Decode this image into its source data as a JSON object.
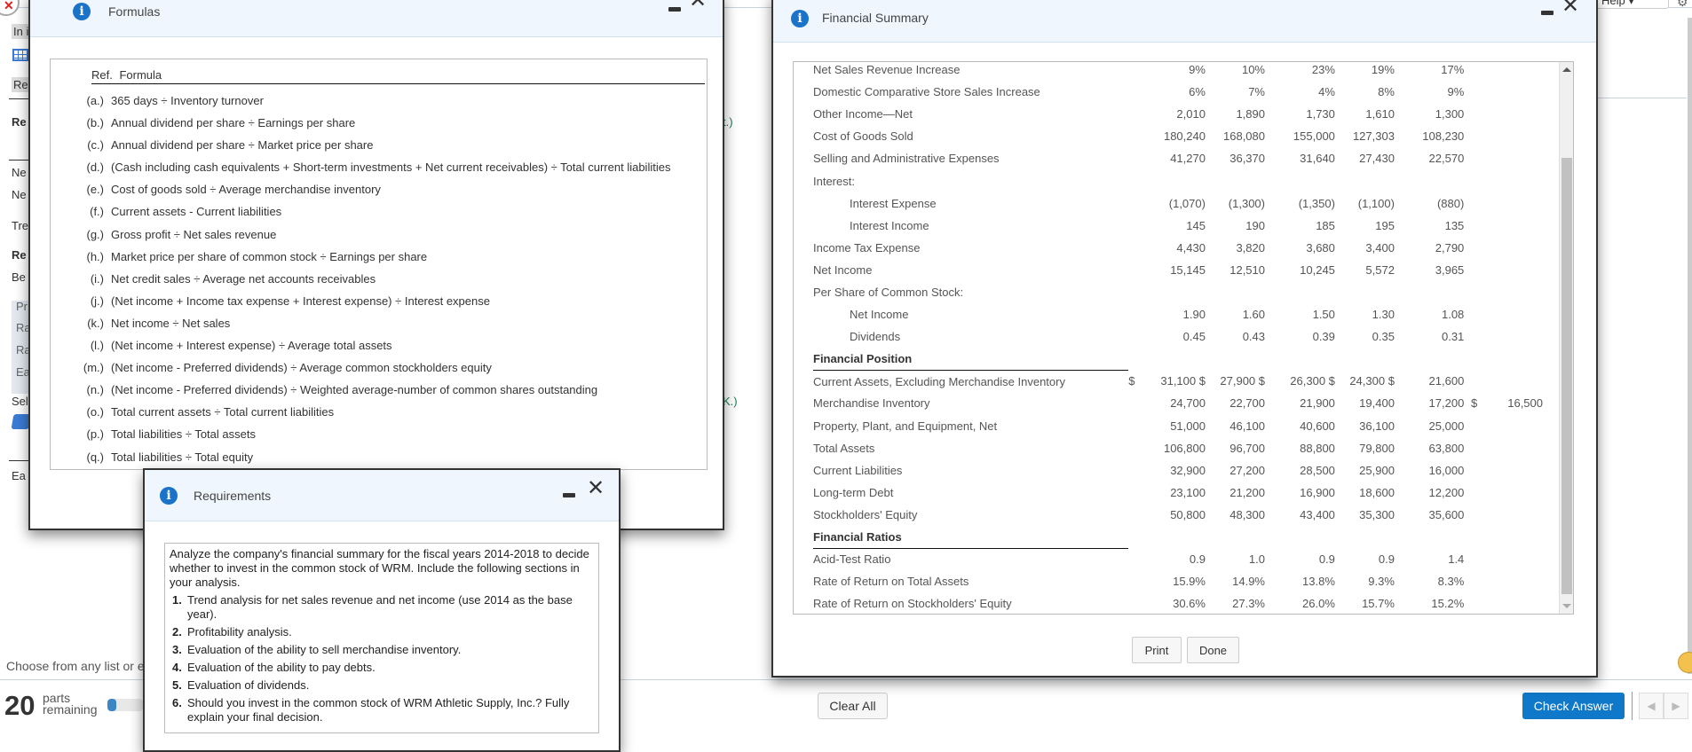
{
  "background": {
    "left_fragments": [
      "In i",
      "Re",
      "Re",
      "Ne",
      "Ne",
      "Tre",
      "Re",
      "Be",
      "Pr",
      "Ra",
      "Ra",
      "Ea",
      "Sel",
      "Ea"
    ],
    "green_fragment_1": "t.)",
    "green_fragment_2": "K.)",
    "choose_text": "Choose from any list or e",
    "parts_count": "20",
    "parts_label_1": "parts",
    "parts_label_2": "remaining",
    "progress_fraction": 0.25,
    "help_label": "Help ▾",
    "clear_all": "Clear All",
    "check_answer": "Check Answer"
  },
  "formulas": {
    "title": "Formulas",
    "header_ref": "Ref.",
    "header_formula": "Formula",
    "rows": [
      {
        "ref": "(a.)",
        "text": "365 days ÷ Inventory turnover"
      },
      {
        "ref": "(b.)",
        "text": "Annual dividend per share ÷ Earnings per share"
      },
      {
        "ref": "(c.)",
        "text": "Annual dividend per share ÷ Market price per share"
      },
      {
        "ref": "(d.)",
        "text": "(Cash including cash equivalents + Short-term investments + Net current receivables) ÷ Total current liabilities"
      },
      {
        "ref": "(e.)",
        "text": "Cost of goods sold ÷ Average merchandise inventory"
      },
      {
        "ref": "(f.)",
        "text": "Current assets - Current liabilities"
      },
      {
        "ref": "(g.)",
        "text": "Gross profit ÷ Net sales revenue"
      },
      {
        "ref": "(h.)",
        "text": "Market price per share of common stock ÷ Earnings per share"
      },
      {
        "ref": "(i.)",
        "text": "Net credit sales ÷ Average net accounts receivables"
      },
      {
        "ref": "(j.)",
        "text": "(Net income + Income tax expense + Interest expense) ÷ Interest expense"
      },
      {
        "ref": "(k.)",
        "text": "Net income ÷ Net sales"
      },
      {
        "ref": "(l.)",
        "text": "(Net income + Interest expense) ÷ Average total assets"
      },
      {
        "ref": "(m.)",
        "text": "(Net income - Preferred dividends) ÷ Average common stockholders equity"
      },
      {
        "ref": "(n.)",
        "text": "(Net income - Preferred dividends) ÷ Weighted average-number of common shares outstanding"
      },
      {
        "ref": "(o.)",
        "text": "Total current assets ÷ Total current liabilities"
      },
      {
        "ref": "(p.)",
        "text": "Total liabilities ÷ Total assets"
      },
      {
        "ref": "(q.)",
        "text": "Total liabilities ÷ Total equity"
      }
    ]
  },
  "requirements": {
    "title": "Requirements",
    "intro": "Analyze the company's financial summary for the fiscal years 2014-2018 to decide whether to invest in the common stock of WRM. Include the following sections in your analysis.",
    "items": [
      {
        "num": "1.",
        "text": "Trend analysis for net sales revenue and net income (use 2014 as the base year)."
      },
      {
        "num": "2.",
        "text": "Profitability analysis."
      },
      {
        "num": "3.",
        "text": "Evaluation of the ability to sell merchandise inventory."
      },
      {
        "num": "4.",
        "text": "Evaluation of the ability to pay debts."
      },
      {
        "num": "5.",
        "text": "Evaluation of dividends."
      },
      {
        "num": "6.",
        "text": "Should you invest in the common stock of WRM Athletic Supply, Inc.? Fully explain your final decision."
      }
    ]
  },
  "financial_summary": {
    "title": "Financial Summary",
    "print_label": "Print",
    "done_label": "Done",
    "rows": [
      {
        "label": "Net Sales Revenue Increase",
        "values": [
          "9%",
          "10%",
          "23%",
          "19%",
          "17%"
        ]
      },
      {
        "label": "Domestic Comparative Store Sales Increase",
        "values": [
          "6%",
          "7%",
          "4%",
          "8%",
          "9%"
        ]
      },
      {
        "label": "Other Income—Net",
        "values": [
          "2,010",
          "1,890",
          "1,730",
          "1,610",
          "1,300"
        ]
      },
      {
        "label": "Cost of Goods Sold",
        "values": [
          "180,240",
          "168,080",
          "155,000",
          "127,303",
          "108,230"
        ]
      },
      {
        "label": "Selling and Administrative Expenses",
        "values": [
          "41,270",
          "36,370",
          "31,640",
          "27,430",
          "22,570"
        ]
      },
      {
        "label": "Interest:",
        "values": []
      },
      {
        "label": "Interest Expense",
        "indent": true,
        "values": [
          "(1,070)",
          "(1,300)",
          "(1,350)",
          "(1,100)",
          "(880)"
        ]
      },
      {
        "label": "Interest Income",
        "indent": true,
        "values": [
          "145",
          "190",
          "185",
          "195",
          "135"
        ]
      },
      {
        "label": "Income Tax Expense",
        "values": [
          "4,430",
          "3,820",
          "3,680",
          "3,400",
          "2,790"
        ]
      },
      {
        "label": "Net Income",
        "values": [
          "15,145",
          "12,510",
          "10,245",
          "5,572",
          "3,965"
        ]
      },
      {
        "label": "Per Share of Common Stock:",
        "values": []
      },
      {
        "label": "Net Income",
        "indent": true,
        "values": [
          "1.90",
          "1.60",
          "1.50",
          "1.30",
          "1.08"
        ]
      },
      {
        "label": "Dividends",
        "indent": true,
        "values": [
          "0.45",
          "0.43",
          "0.39",
          "0.35",
          "0.31"
        ]
      },
      {
        "label": "Financial Position",
        "section": true,
        "values": []
      },
      {
        "label": "Current Assets, Excluding Merchandise Inventory",
        "currency": true,
        "values": [
          "31,100",
          "27,900",
          "26,300",
          "24,300",
          "21,600"
        ]
      },
      {
        "label": "Merchandise Inventory",
        "values": [
          "24,700",
          "22,700",
          "21,900",
          "19,400",
          "17,200"
        ],
        "extra_currency": "$",
        "extra": "16,500"
      },
      {
        "label": "Property, Plant, and Equipment, Net",
        "values": [
          "51,000",
          "46,100",
          "40,600",
          "36,100",
          "25,000"
        ]
      },
      {
        "label": "Total Assets",
        "values": [
          "106,800",
          "96,700",
          "88,800",
          "79,800",
          "63,800"
        ]
      },
      {
        "label": "Current Liabilities",
        "values": [
          "32,900",
          "27,200",
          "28,500",
          "25,900",
          "16,000"
        ]
      },
      {
        "label": "Long-term Debt",
        "values": [
          "23,100",
          "21,200",
          "16,900",
          "18,600",
          "12,200"
        ]
      },
      {
        "label": "Stockholders' Equity",
        "values": [
          "50,800",
          "48,300",
          "43,400",
          "35,300",
          "35,600"
        ]
      },
      {
        "label": "Financial Ratios",
        "section": true,
        "values": []
      },
      {
        "label": "Acid-Test Ratio",
        "values": [
          "0.9",
          "1.0",
          "0.9",
          "0.9",
          "1.4"
        ]
      },
      {
        "label": "Rate of Return on Total Assets",
        "values": [
          "15.9%",
          "14.9%",
          "13.8%",
          "9.3%",
          "8.3%"
        ]
      },
      {
        "label": "Rate of Return on Stockholders' Equity",
        "last": true,
        "values": [
          "30.6%",
          "27.3%",
          "26.0%",
          "15.7%",
          "15.2%"
        ]
      }
    ]
  }
}
